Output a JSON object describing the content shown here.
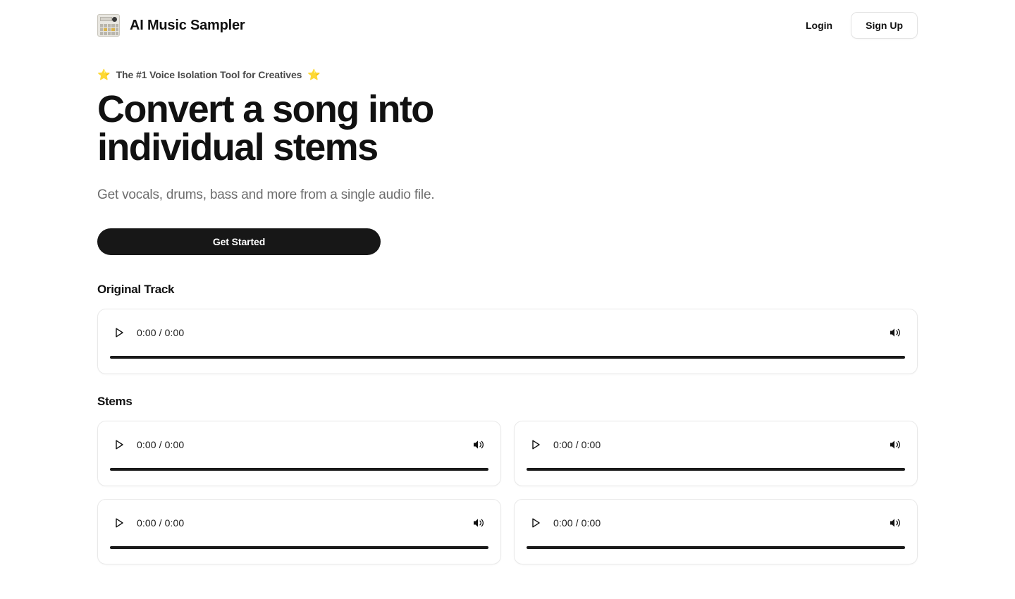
{
  "header": {
    "brand_name": "AI Music Sampler",
    "logo_icon": "sampler-device-icon",
    "login_label": "Login",
    "signup_label": "Sign Up"
  },
  "hero": {
    "tagline": "The #1 Voice Isolation Tool for Creatives",
    "tagline_star_left": "⭐",
    "tagline_star_right": "⭐",
    "title_line1": "Convert a song into",
    "title_line2": "individual stems",
    "subtitle": "Get vocals, drums, bass and more from a single audio file.",
    "cta_label": "Get Started"
  },
  "sections": {
    "original_title": "Original Track",
    "stems_title": "Stems"
  },
  "players": {
    "original": {
      "time": "0:00 / 0:00",
      "play_icon": "play-icon",
      "volume_icon": "volume-icon",
      "progress_percent": 100
    },
    "stems": [
      {
        "time": "0:00 / 0:00",
        "play_icon": "play-icon",
        "volume_icon": "volume-icon",
        "progress_percent": 100
      },
      {
        "time": "0:00 / 0:00",
        "play_icon": "play-icon",
        "volume_icon": "volume-icon",
        "progress_percent": 100
      },
      {
        "time": "0:00 / 0:00",
        "play_icon": "play-icon",
        "volume_icon": "volume-icon",
        "progress_percent": 100
      },
      {
        "time": "0:00 / 0:00",
        "play_icon": "play-icon",
        "volume_icon": "volume-icon",
        "progress_percent": 100
      }
    ]
  },
  "colors": {
    "background": "#ffffff",
    "text_primary": "#111111",
    "text_muted": "#6d6d6d",
    "cta_background": "#171717",
    "cta_text": "#ffffff",
    "card_border": "#e9e9e9",
    "progress_bar": "#1a1a1a"
  }
}
